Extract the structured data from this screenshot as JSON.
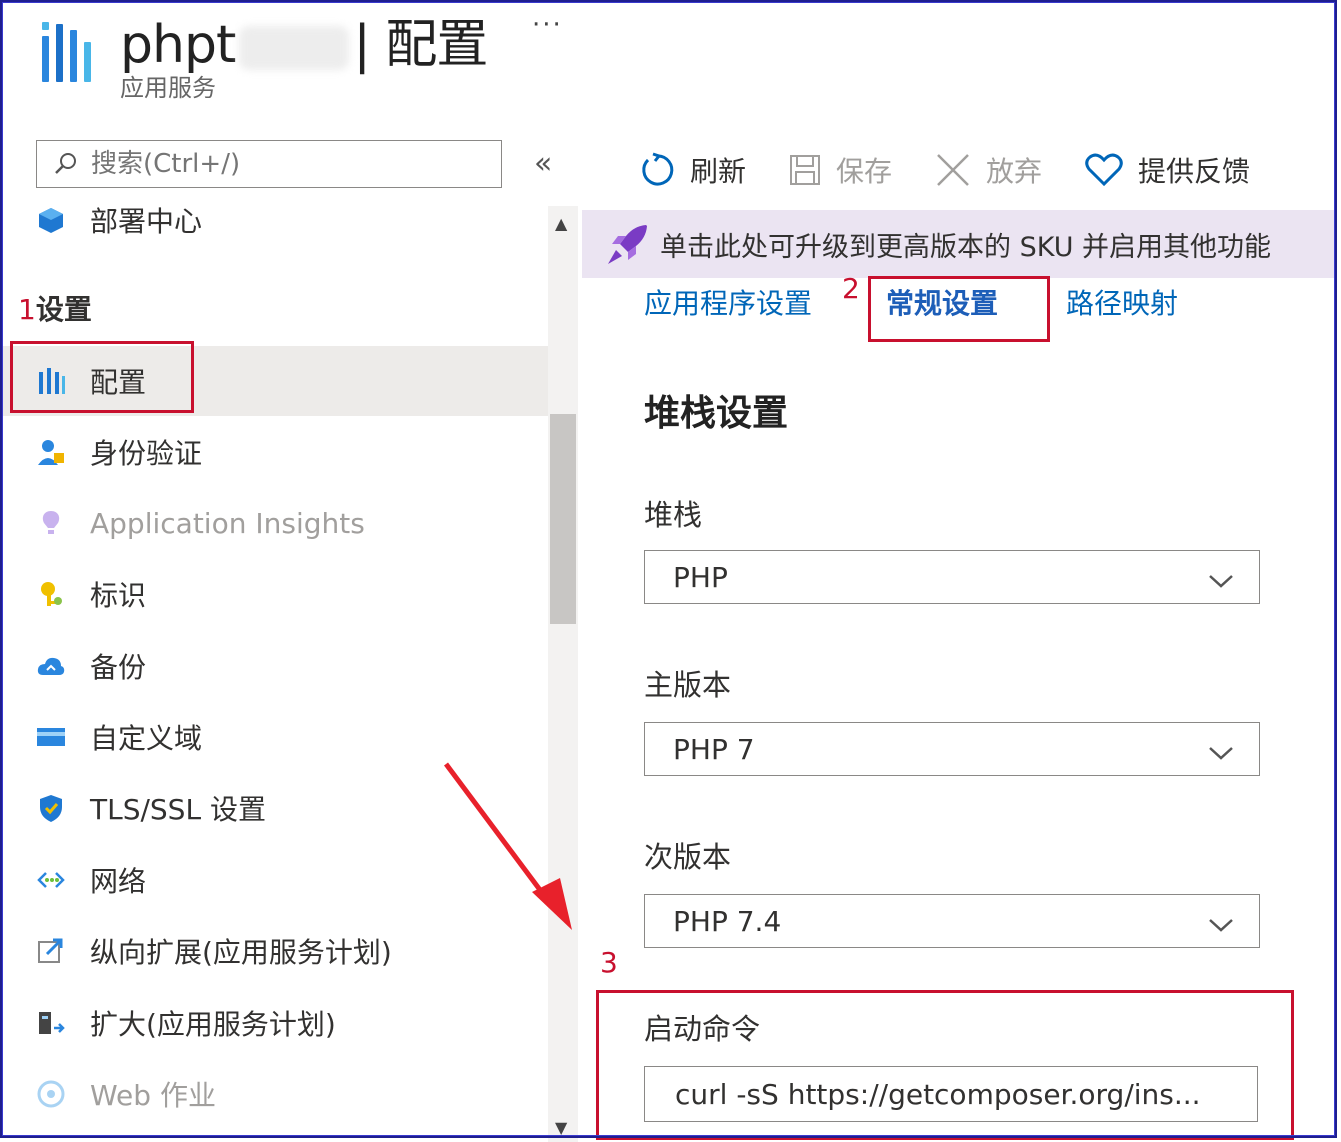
{
  "header": {
    "title_prefix": "phpt",
    "title_suffix": "| 配置",
    "subtitle": "应用服务",
    "more": "···"
  },
  "search": {
    "placeholder": "搜索(Ctrl+/)",
    "collapse": "«"
  },
  "sidebar": {
    "top_item": "部署中心",
    "section_number": "1",
    "section_title": "设置",
    "items": [
      {
        "label": "配置",
        "icon": "config-icon"
      },
      {
        "label": "身份验证",
        "icon": "identity-icon"
      },
      {
        "label": "Application Insights",
        "icon": "insights-icon"
      },
      {
        "label": "标识",
        "icon": "key-icon"
      },
      {
        "label": "备份",
        "icon": "backup-cloud-icon"
      },
      {
        "label": "自定义域",
        "icon": "domain-icon"
      },
      {
        "label": "TLS/SSL 设置",
        "icon": "shield-icon"
      },
      {
        "label": "网络",
        "icon": "network-icon"
      },
      {
        "label": "纵向扩展(应用服务计划)",
        "icon": "scale-up-icon"
      },
      {
        "label": "扩大(应用服务计划)",
        "icon": "scale-out-icon"
      },
      {
        "label": "Web 作业",
        "icon": "webjob-icon"
      }
    ]
  },
  "toolbar": {
    "refresh": "刷新",
    "save": "保存",
    "discard": "放弃",
    "feedback": "提供反馈"
  },
  "banner": {
    "text": "单击此处可升级到更高版本的 SKU 并启用其他功能"
  },
  "tabs": {
    "app_settings": "应用程序设置",
    "general_settings": "常规设置",
    "general_number": "2",
    "path_mappings": "路径映射"
  },
  "stack": {
    "title": "堆栈设置",
    "stack_label": "堆栈",
    "stack_value": "PHP",
    "major_label": "主版本",
    "major_value": "PHP 7",
    "minor_label": "次版本",
    "minor_value": "PHP 7.4",
    "startup_number": "3",
    "startup_label": "启动命令",
    "startup_value": "curl -sS https://getcomposer.org/ins..."
  },
  "colors": {
    "accent": "#0066b8",
    "annotation": "#c8102e",
    "banner_bg": "#ebe4f2"
  }
}
